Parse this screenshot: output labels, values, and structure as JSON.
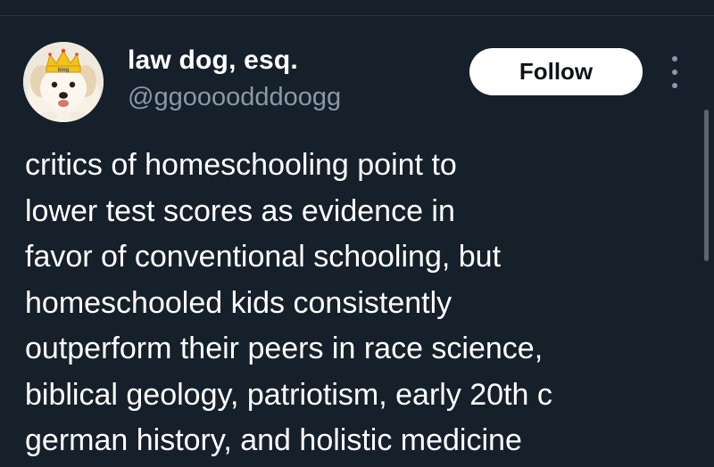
{
  "author": {
    "display_name": "law dog, esq.",
    "handle": "@ggoooodddoogg",
    "avatar_crown_text": "king"
  },
  "actions": {
    "follow_label": "Follow",
    "more_icon": "more-vertical-icon"
  },
  "tweet": {
    "lines": [
      "critics of homeschooling point to",
      "lower test scores as evidence in",
      "favor of conventional schooling, but",
      "homeschooled kids consistently",
      "outperform their peers in race science,",
      "biblical geology, patriotism, early 20th c",
      "german history, and holistic medicine"
    ]
  },
  "colors": {
    "background": "#15202b",
    "text_primary": "#ffffff",
    "text_secondary": "#8b98a5",
    "button_bg": "#ffffff",
    "button_text": "#0f1419"
  }
}
